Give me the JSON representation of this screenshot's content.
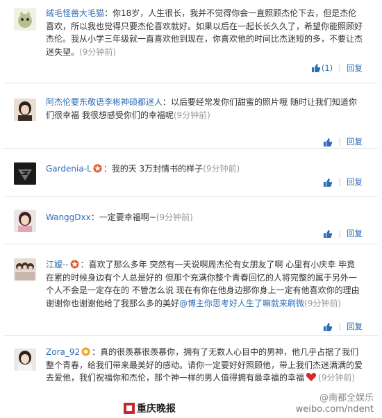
{
  "comments": [
    {
      "author": "绒毛怪兽大毛猫",
      "text": "：你18岁，人生很长，我并不觉得你会一直照顾杰伦下去，但是杰伦喜欢，所以我也觉得只要杰伦喜欢就好。如果以后在一起长长久久了，希望你能照顾好杰伦。我从小学三年级就一直喜欢他到现在，你喜欢他的时间比杰迷短的多，不要让杰迷失望。",
      "time": "(9分钟前)",
      "like_count": "(1)",
      "reply": "回复"
    },
    {
      "author": "阿杰伦要东敬语李彬神硕都迷人",
      "text": "：以后要经常发你们甜蜜的照片哦 随时让我们知道你们很幸福 我很想感受你们的幸福呢",
      "time": "(9分钟前)",
      "reply": "回复"
    },
    {
      "author": "Gardenia-L",
      "text": "：我的天 3万封情书的样子",
      "time": "(9分钟前)",
      "reply": "回复"
    },
    {
      "author": "WanggDxx",
      "text": "：一定要幸福啊~",
      "time": "(9分钟前)",
      "reply": "回复"
    },
    {
      "author": "江嫒--",
      "text": "：喜欢了那么多年 突然有一天说啊周杰伦有女朋友了啊 心里有小庆幸 毕竟在累的时候身边有个人总是好的 但那个充满你整个青春回忆的人将完整的属于另外一个人不会是一定存在的 不管怎么说 现在有你在他身边那你身上一定有他喜欢你的理由 谢谢你也谢谢他给了我那么多的美好",
      "mention": "@博主你思考好人生了嘛就来刷微",
      "time": "(9分钟前)",
      "reply": "回复"
    },
    {
      "author": "Zora_92",
      "text": "：真的很羡慕很羡慕你，拥有了无数人心目中的男神，他几乎占据了我们整个青春，给我们带来最美好的感动。请你一定要好好照顾他，带上我们杰迷满满的爱去爱他，我们祝福你和杰伦，那个神一样的男人值得拥有最幸福的幸福",
      "time": "(9分钟前)",
      "reply": "回复"
    }
  ],
  "footer": {
    "logo_text": "重庆晚报",
    "watermark_top": "@南都全娱乐",
    "watermark_bottom": "weibo.com/ndent"
  },
  "colors": {
    "link": "#2f6db5",
    "text": "#333333",
    "muted": "#999999",
    "border": "#e3e3e3"
  }
}
